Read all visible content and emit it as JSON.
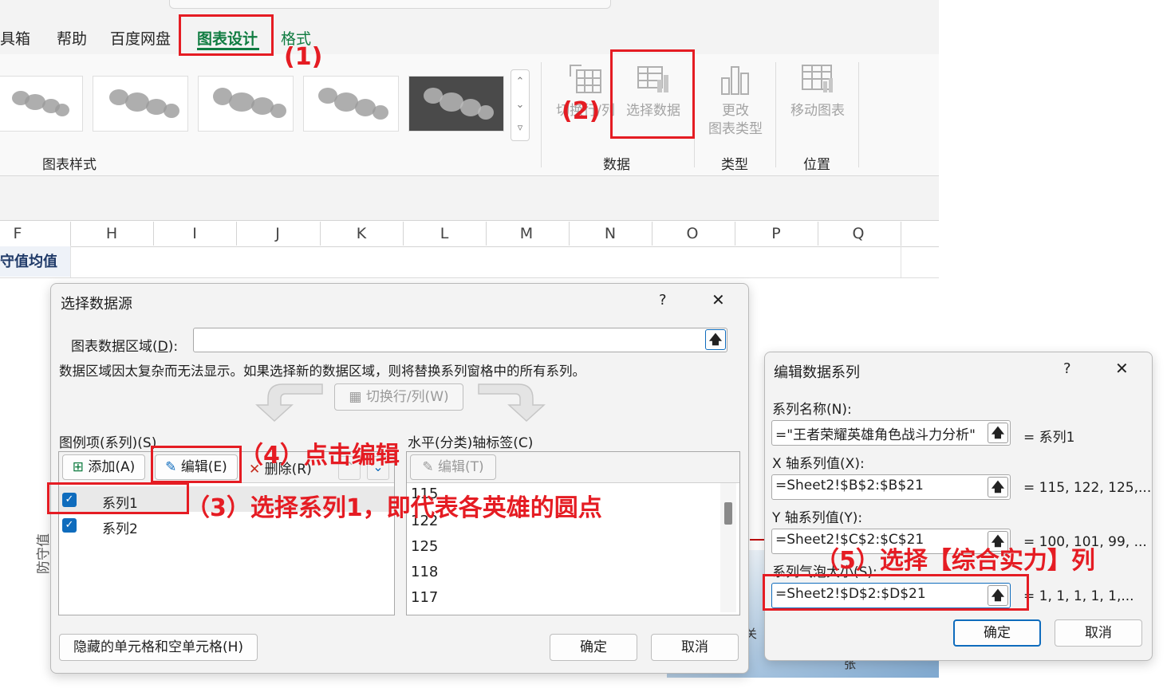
{
  "ribbon": {
    "tabs": [
      "工具箱",
      "帮助",
      "百度网盘",
      "图表设计",
      "格式"
    ],
    "tab_truncated_first": "具箱",
    "active_tab": "图表设计",
    "styles_group_label": "图表样式",
    "data_group": {
      "label": "数据",
      "switch_row_col": "切换行/列",
      "select_data": "选择数据"
    },
    "type_group": {
      "label": "类型",
      "change_type_line1": "更改",
      "change_type_line2": "图表类型"
    },
    "location_group": {
      "label": "位置",
      "move_chart": "移动图表"
    }
  },
  "sheet": {
    "columns": [
      "F",
      "H",
      "I",
      "J",
      "K",
      "L",
      "M",
      "N",
      "O",
      "P",
      "Q"
    ],
    "cell_text": "守值均值",
    "axis_label": "防守值",
    "bottom_fragment_1": "关",
    "bottom_fragment_2": "张"
  },
  "select_data_dialog": {
    "title": "选择数据源",
    "help": "?",
    "close": "✕",
    "range_label": "图表数据区域(D):",
    "range_label_main": "图表数据区域(",
    "range_label_key": "D",
    "range_label_end": "):",
    "range_value": "",
    "info": "数据区域因太复杂而无法显示。如果选择新的数据区域，则将替换系列窗格中的所有系列。",
    "switch_button": "切换行/列(W)",
    "legend_label": "图例项(系列)(S)",
    "axis_label": "水平(分类)轴标签(C)",
    "add_button": "添加(A)",
    "edit_button": "编辑(E)",
    "delete_button": "删除(R)",
    "axis_edit_button": "编辑(T)",
    "series": [
      {
        "name": "系列1",
        "checked": true
      },
      {
        "name": "系列2",
        "checked": true
      }
    ],
    "axis_values": [
      "115",
      "122",
      "125",
      "118",
      "117"
    ],
    "hidden_cells_button": "隐藏的单元格和空单元格(H)",
    "ok": "确定",
    "cancel": "取消"
  },
  "edit_series_dialog": {
    "title": "编辑数据系列",
    "help": "?",
    "close": "✕",
    "name_label": "系列名称(N):",
    "name_value": "=\"王者荣耀英雄角色战斗力分析\"",
    "name_result": "= 系列1",
    "x_label": "X 轴系列值(X):",
    "x_value": "=Sheet2!$B$2:$B$21",
    "x_result": "= 115, 122, 125,...",
    "y_label": "Y 轴系列值(Y):",
    "y_value": "=Sheet2!$C$2:$C$21",
    "y_result": "= 100, 101, 99, ...",
    "size_label": "系列气泡大小(S):",
    "size_value": "=Sheet2!$D$2:$D$21",
    "size_result": "= 1, 1, 1, 1, 1,...",
    "ok": "确定",
    "cancel": "取消"
  },
  "annotations": {
    "step1": "(1)",
    "step2": "(2)",
    "step3": "（3）选择系列1，即代表各英雄的圆点",
    "step4": "（4）点击编辑",
    "step5": "（5）选择【综合实力】列"
  },
  "colors": {
    "accent_green": "#107c41",
    "annotation_red": "#e51c23",
    "dialog_blue": "#0f6cbd"
  }
}
